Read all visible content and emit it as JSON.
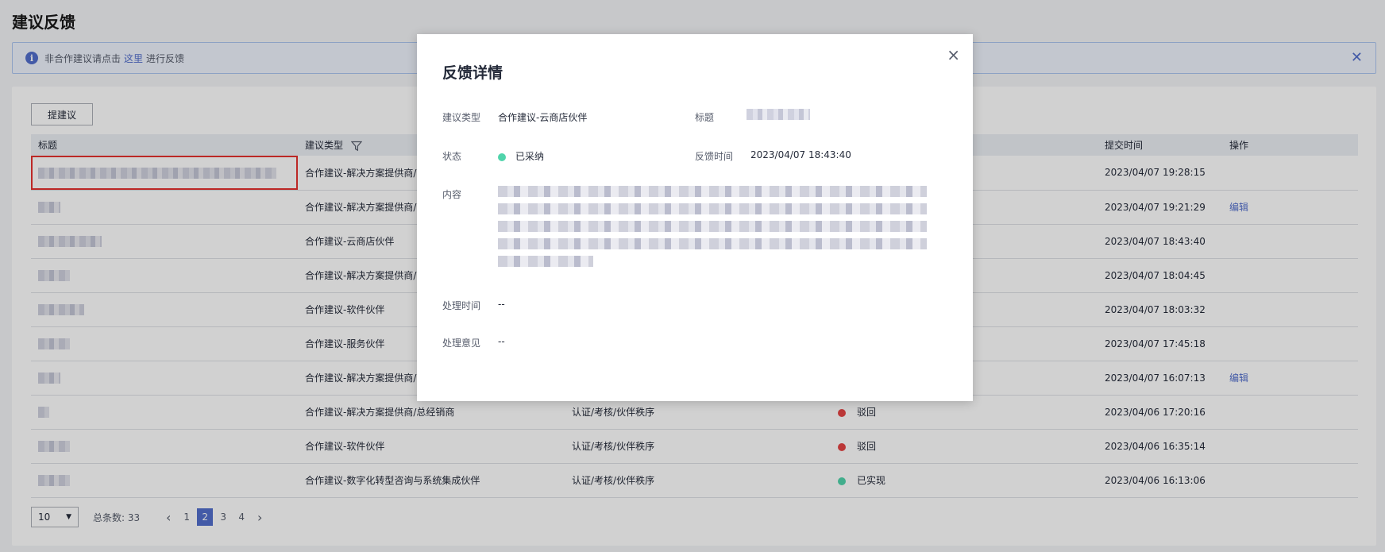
{
  "page": {
    "title": "建议反馈"
  },
  "notice": {
    "prefix": "非合作建议请点击",
    "link": "这里",
    "suffix": "进行反馈"
  },
  "toolbar": {
    "suggest_label": "提建议"
  },
  "table": {
    "headers": [
      "标题",
      "建议类型",
      "",
      "",
      "提交时间",
      "操作"
    ],
    "rows": [
      {
        "type": "合作建议-解决方案提供商/",
        "category": "",
        "status": "",
        "status_color": "",
        "time": "2023/04/07 19:28:15",
        "action": ""
      },
      {
        "type": "合作建议-解决方案提供商/",
        "category": "",
        "status": "",
        "status_color": "",
        "time": "2023/04/07 19:21:29",
        "action": "编辑"
      },
      {
        "type": "合作建议-云商店伙伴",
        "category": "",
        "status": "",
        "status_color": "",
        "time": "2023/04/07 18:43:40",
        "action": ""
      },
      {
        "type": "合作建议-解决方案提供商/",
        "category": "",
        "status": "",
        "status_color": "",
        "time": "2023/04/07 18:04:45",
        "action": ""
      },
      {
        "type": "合作建议-软件伙伴",
        "category": "",
        "status": "",
        "status_color": "",
        "time": "2023/04/07 18:03:32",
        "action": ""
      },
      {
        "type": "合作建议-服务伙伴",
        "category": "",
        "status": "",
        "status_color": "",
        "time": "2023/04/07 17:45:18",
        "action": ""
      },
      {
        "type": "合作建议-解决方案提供商/",
        "category": "",
        "status": "",
        "status_color": "",
        "time": "2023/04/07 16:07:13",
        "action": "编辑"
      },
      {
        "type": "合作建议-解决方案提供商/总经销商",
        "category": "认证/考核/伙伴秩序",
        "status": "驳回",
        "status_color": "#e54545",
        "time": "2023/04/06 17:20:16",
        "action": ""
      },
      {
        "type": "合作建议-软件伙伴",
        "category": "认证/考核/伙伴秩序",
        "status": "驳回",
        "status_color": "#e54545",
        "time": "2023/04/06 16:35:14",
        "action": ""
      },
      {
        "type": "合作建议-数字化转型咨询与系统集成伙伴",
        "category": "认证/考核/伙伴秩序",
        "status": "已实现",
        "status_color": "#50d4ab",
        "time": "2023/04/06 16:13:06",
        "action": ""
      }
    ]
  },
  "pager": {
    "size": "10",
    "total_label": "总条数:",
    "total": "33",
    "prev": "‹",
    "next": "›",
    "pages": [
      "1",
      "2",
      "3",
      "4"
    ],
    "current": "2"
  },
  "modal": {
    "title": "反馈详情",
    "close": "×",
    "type_label": "建议类型",
    "type_value": "合作建议-云商店伙伴",
    "title_label": "标题",
    "status_label": "状态",
    "status_value": "已采纳",
    "status_color": "#50d4ab",
    "time_label": "反馈时间",
    "time_value": "2023/04/07 18:43:40",
    "content_label": "内容",
    "process_time_label": "处理时间",
    "process_time_value": "--",
    "opinion_label": "处理意见",
    "opinion_value": "--"
  },
  "colors": {
    "accent": "#526ecc",
    "highlight": "#e6312f"
  }
}
